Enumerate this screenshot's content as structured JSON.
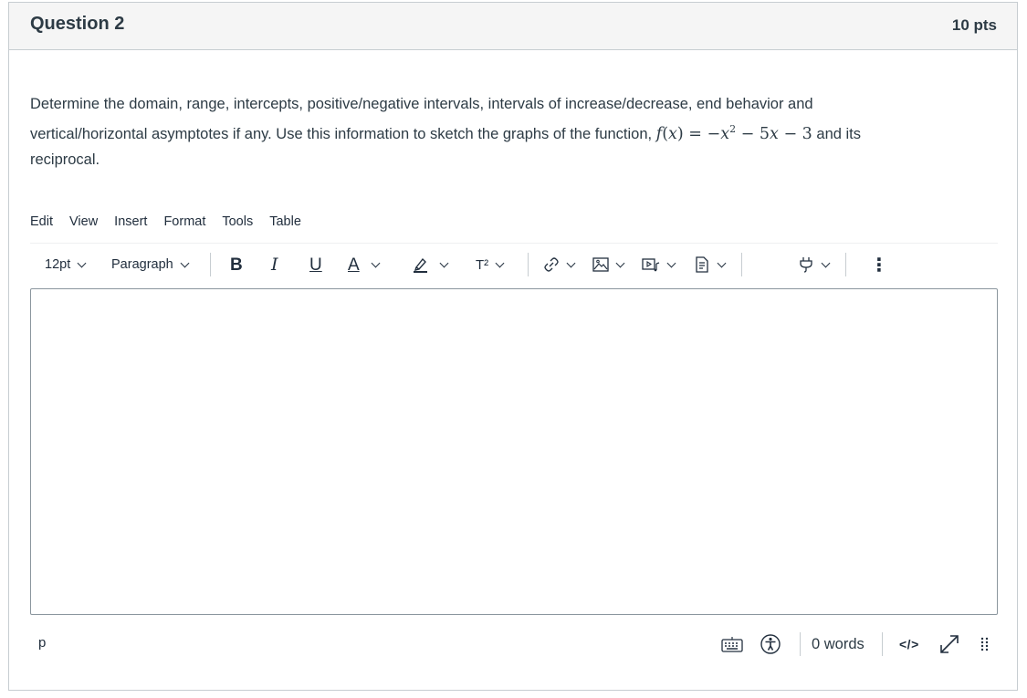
{
  "question": {
    "title": "Question 2",
    "points": "10 pts",
    "text_line1": "Determine the domain, range, intercepts, positive/negative intervals, intervals of increase/decrease, end behavior and",
    "text_line2_pre": "vertical/horizontal asymptotes if any. Use this information to sketch the graphs of the function,",
    "math_f": "f",
    "math_paren_open": "(",
    "math_x": "x",
    "math_rest1": ") = −",
    "math_x2": "x",
    "math_exp": "2",
    "math_rest2": " − 5",
    "math_x3": "x",
    "math_rest3": " − 3",
    "text_line2_post": " and its",
    "text_line3": "reciprocal."
  },
  "menubar": {
    "items": [
      "Edit",
      "View",
      "Insert",
      "Format",
      "Tools",
      "Table"
    ]
  },
  "toolbar": {
    "font_size": "12pt",
    "block_format": "Paragraph",
    "bold": "B",
    "italic": "I",
    "underline": "U",
    "text_color": "A",
    "superscript": "T²",
    "more": "⋮"
  },
  "editor": {
    "content": ""
  },
  "statusbar": {
    "path": "p",
    "word_count": "0 words",
    "html_toggle": "</>"
  },
  "icons": {
    "link": "link-icon",
    "image": "image-icon",
    "media": "media-icon",
    "document": "document-icon",
    "plugin": "plug-icon",
    "keyboard": "keyboard-icon",
    "accessibility": "accessibility-icon",
    "fullscreen": "fullscreen-icon",
    "resize": "resize-grip-icon"
  },
  "colors": {
    "header_bg": "#f5f5f5",
    "border": "#c7cdd1",
    "text": "#2d3b45"
  }
}
